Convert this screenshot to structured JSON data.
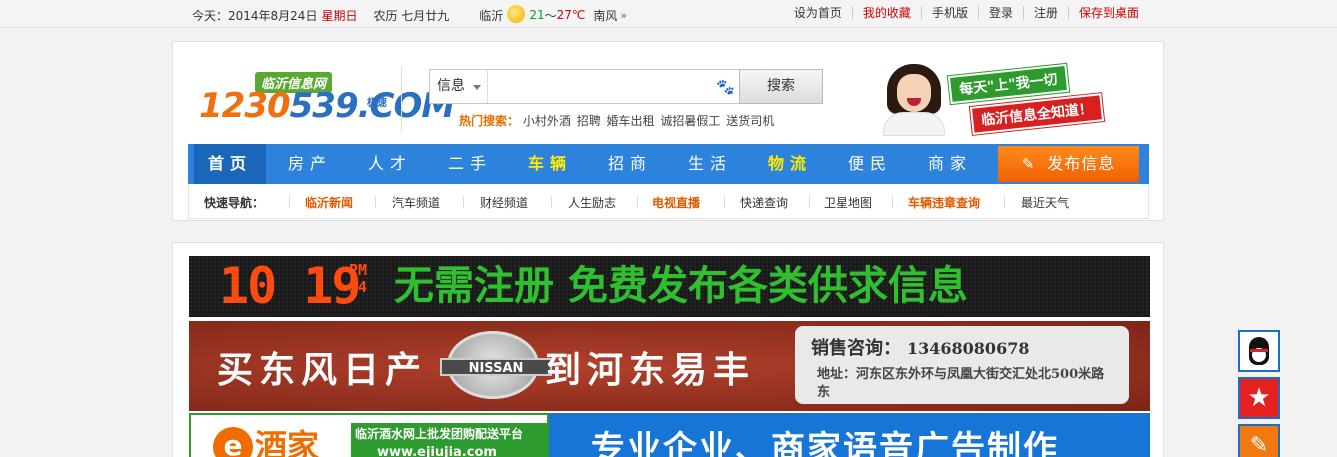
{
  "topbar": {
    "date": "今天：2014年8月24日",
    "weekday": "星期日",
    "lunar": "农历 七月廿九",
    "city": "临沂",
    "weather_icon": "sun-cloud-icon",
    "temp_low": "21",
    "temp_sep": "～",
    "temp_high": "27℃",
    "wind": "南风",
    "links": [
      "设为首页",
      "我的收藏",
      "手机版",
      "登录",
      "注册",
      "保存到桌面"
    ]
  },
  "logo": {
    "site_name": "临沂信息网",
    "number_a": "1230",
    "number_b": "539",
    "suffix": ".COM",
    "speed_tag": "极速"
  },
  "search": {
    "type_label": "信息",
    "placeholder": "",
    "button_label": "搜索",
    "hot_label": "热门搜索：",
    "hot_terms": [
      "小村外酒",
      "招聘",
      "婚车出租",
      "诚招暑假工",
      "送货司机"
    ]
  },
  "promo": {
    "line1": "每天\"上\"我一切",
    "line2": "临沂信息全知道！"
  },
  "nav": {
    "items": [
      "首页",
      "房产",
      "人才",
      "二手",
      "车辆",
      "招商",
      "生活",
      "物流",
      "便民",
      "商家"
    ],
    "publish_label": "发布信息"
  },
  "quick_nav": {
    "label": "快速导航：",
    "items": [
      "临沂新闻",
      "汽车频道",
      "财经频道",
      "人生励志",
      "电视直播",
      "快递查询",
      "卫星地图",
      "车辆违章查询",
      "最近天气"
    ]
  },
  "banners": {
    "led_hour": "10",
    "led_minute": "19",
    "led_pm": "PM",
    "led_seconds": "34",
    "led_message": "无需注册 免费发布各类供求信息",
    "nissan_slogan_a": "买东风日产",
    "nissan_logo": "NISSAN",
    "nissan_slogan_b": "到河东易丰",
    "sales_label": "销售咨询：",
    "sales_phone": "13468080678",
    "sales_address": "地址：河东区东外环与凤凰大街交汇处北500米路东",
    "wine_logo_e": "e",
    "wine_logo_text": "酒家",
    "wine_tagline": "临沂酒水网上批发团购配送平台",
    "wine_url": "www.ejiujia.com",
    "voice_ad": "专业企业、商家语音广告制作"
  },
  "colors": {
    "nav_blue": "#2d83db",
    "publish_orange": "#f06000",
    "accent_red": "#d40000",
    "quick_orange": "#e05a00"
  }
}
